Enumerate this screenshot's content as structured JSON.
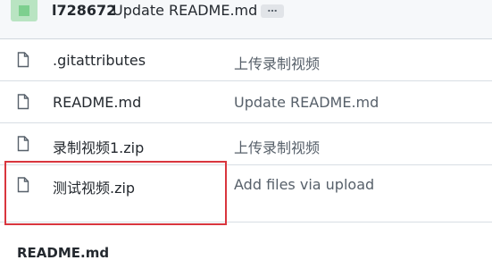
{
  "commit": {
    "author": "l728672",
    "message": "Update README.md",
    "more": "…"
  },
  "files": [
    {
      "name": ".gitattributes",
      "message": "上传录制视频",
      "icon": "file-icon"
    },
    {
      "name": "README.md",
      "message": "Update README.md",
      "icon": "file-icon"
    },
    {
      "name": "录制视频1.zip",
      "message": "上传录制视频",
      "icon": "file-icon"
    },
    {
      "name": "测试视频.zip",
      "message": "Add files via upload",
      "icon": "file-icon"
    }
  ],
  "readme": {
    "title": "README.md"
  },
  "colors": {
    "highlight": "#d9363e",
    "border": "#d0d7de",
    "muted": "#57606a"
  }
}
